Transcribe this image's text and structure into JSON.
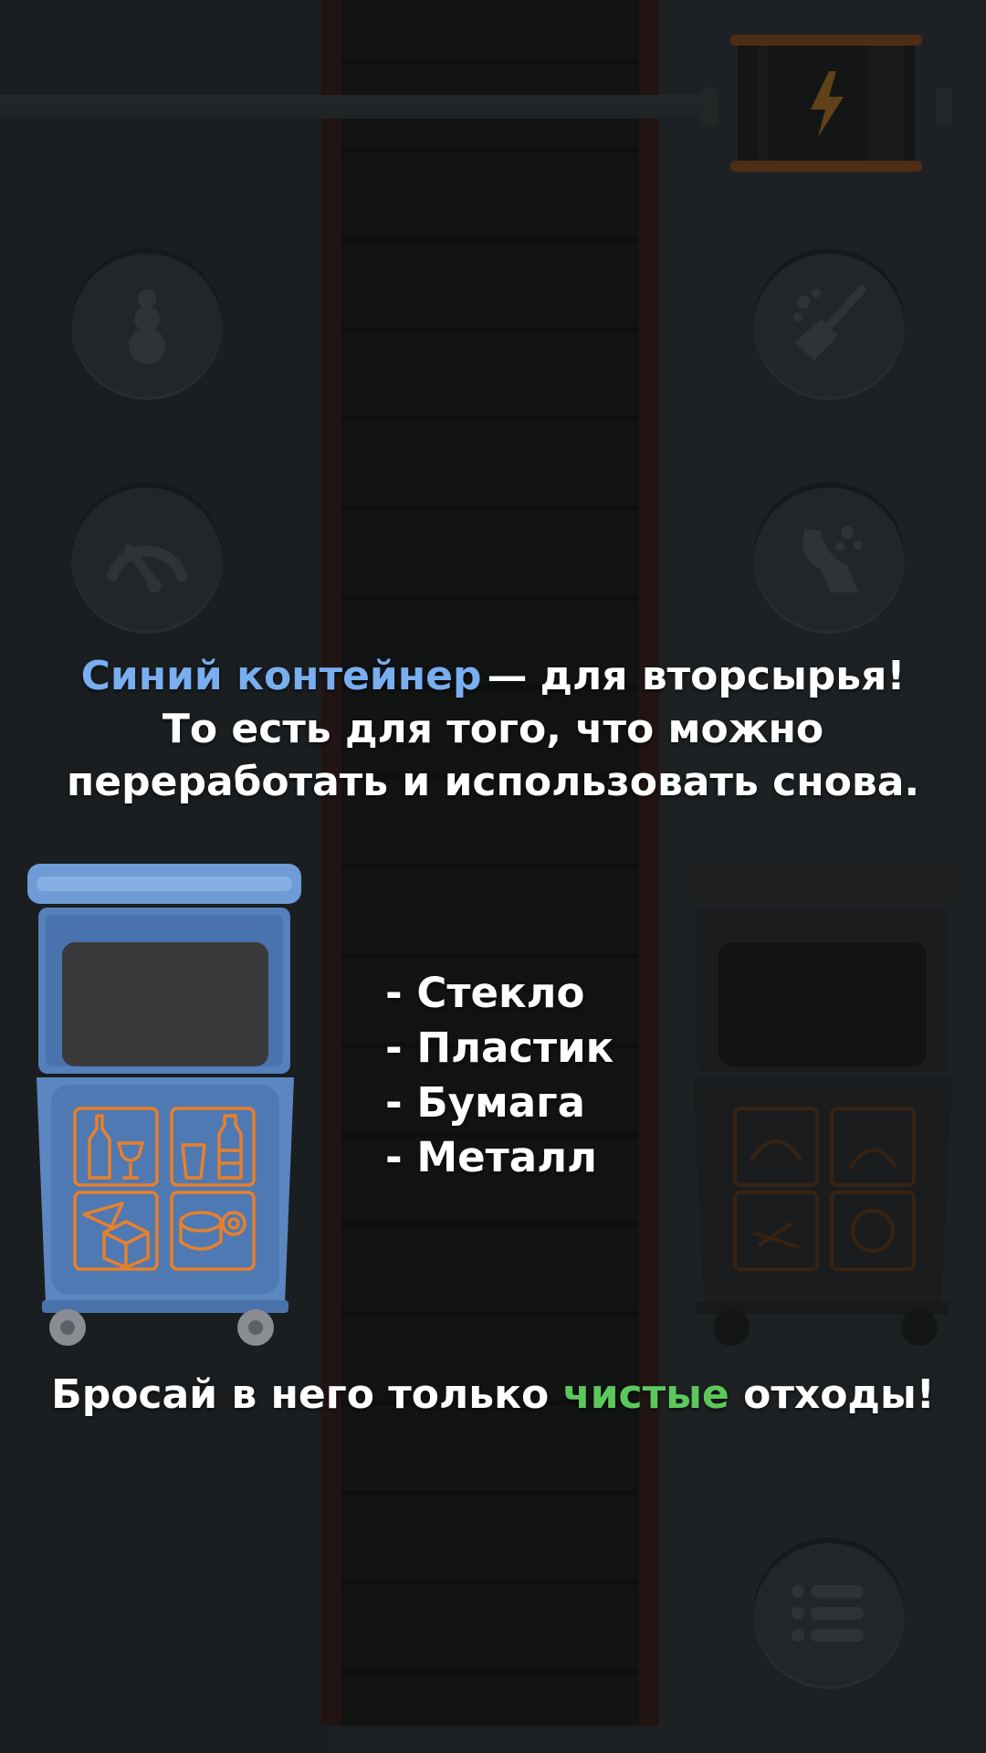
{
  "tutorial": {
    "headline_blue": "Синий контейнер",
    "headline_dash": "—",
    "headline_rest": "для вторсырья!",
    "headline_line2": "То есть для того, что можно",
    "headline_line3": "переработать и использовать снова.",
    "items": [
      "- Стекло",
      "- Пластик",
      "- Бумага",
      "- Металл"
    ],
    "footer_before": "Бросай в него только",
    "footer_green": "чистые",
    "footer_after": "отходы!"
  },
  "colors": {
    "accent_blue": "#79aef0",
    "accent_green": "#5cc85c",
    "bin_blue": "#5b86c0",
    "icon_orange": "#e8802a"
  },
  "icons": {
    "left_buttons": [
      "snowman-icon",
      "speedometer-icon"
    ],
    "right_buttons": [
      "broom-icon",
      "vacuum-icon"
    ],
    "menu_button": "menu-list-icon",
    "battery": "lightning-icon",
    "blue_bin_icons": [
      "glass-bottle-icon",
      "plastic-bottle-icon",
      "paper-box-icon",
      "metal-can-icon"
    ],
    "dark_bin_icons": [
      "food-waste-icon",
      "banana-peel-icon",
      "bones-icon",
      "pizza-icon"
    ]
  }
}
